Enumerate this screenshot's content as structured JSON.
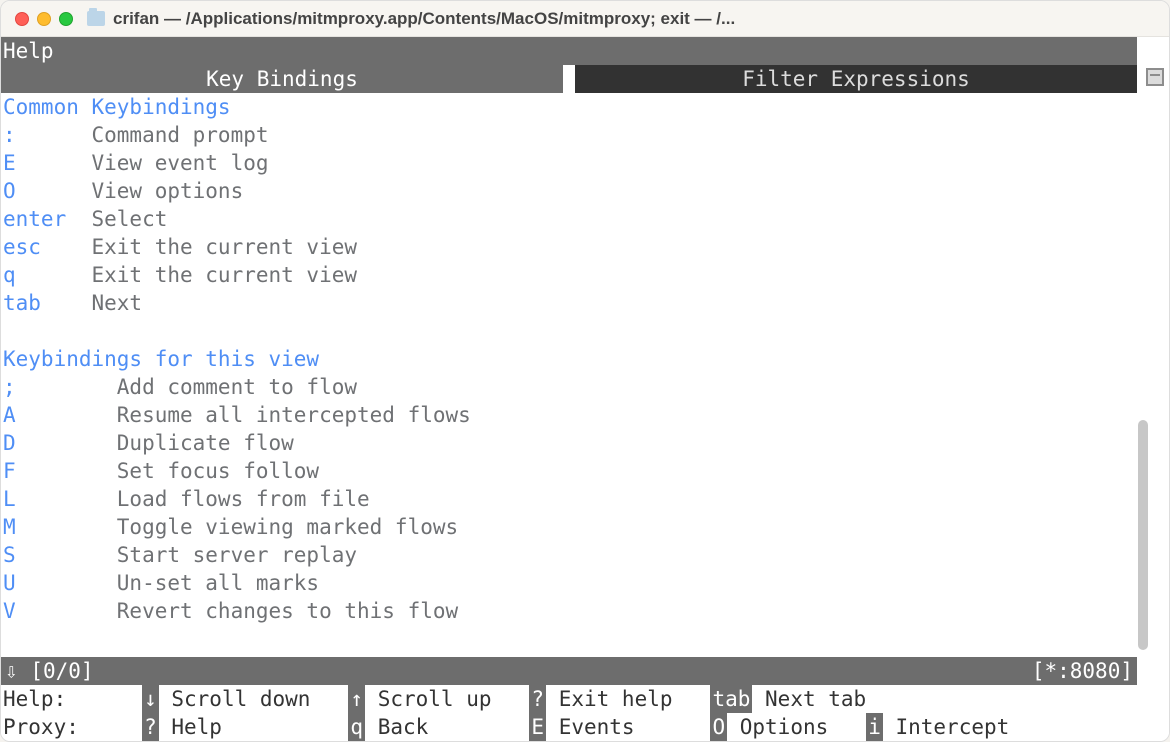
{
  "window": {
    "title": "crifan — /Applications/mitmproxy.app/Contents/MacOS/mitmproxy; exit — /..."
  },
  "header": "Help",
  "tabs": {
    "active": "Key Bindings",
    "inactive": "Filter Expressions"
  },
  "sections": [
    {
      "title": "Common Keybindings",
      "keyWidth": "w6",
      "items": [
        {
          "key": ":",
          "desc": "Command prompt"
        },
        {
          "key": "E",
          "desc": "View event log"
        },
        {
          "key": "O",
          "desc": "View options"
        },
        {
          "key": "enter",
          "desc": "Select"
        },
        {
          "key": "esc",
          "desc": "Exit the current view"
        },
        {
          "key": "q",
          "desc": "Exit the current view"
        },
        {
          "key": "tab",
          "desc": "Next"
        }
      ]
    },
    {
      "title": "Keybindings for this view",
      "keyWidth": "w8",
      "items": [
        {
          "key": ";",
          "desc": "Add comment to flow"
        },
        {
          "key": "A",
          "desc": "Resume all intercepted flows"
        },
        {
          "key": "D",
          "desc": "Duplicate flow"
        },
        {
          "key": "F",
          "desc": "Set focus follow"
        },
        {
          "key": "L",
          "desc": "Load flows from file"
        },
        {
          "key": "M",
          "desc": "Toggle viewing marked flows"
        },
        {
          "key": "S",
          "desc": "Start server replay"
        },
        {
          "key": "U",
          "desc": "Un-set all marks"
        },
        {
          "key": "V",
          "desc": "Revert changes to this flow"
        }
      ]
    }
  ],
  "status": {
    "leftArrow": "⇩",
    "count": "[0/0]",
    "right": "[*:8080]"
  },
  "footer": {
    "rows": [
      {
        "label": "Help:",
        "items": [
          {
            "key": "↓",
            "action": "Scroll down"
          },
          {
            "key": "↑",
            "action": "Scroll up"
          },
          {
            "key": "?",
            "action": "Exit help"
          },
          {
            "key": "tab",
            "action": "Next tab"
          }
        ]
      },
      {
        "label": "Proxy:",
        "items": [
          {
            "key": "?",
            "action": "Help"
          },
          {
            "key": "q",
            "action": "Back"
          },
          {
            "key": "E",
            "action": "Events"
          },
          {
            "key": "O",
            "action": "Options"
          },
          {
            "key": "i",
            "action": "Intercept"
          }
        ]
      }
    ]
  },
  "footerColWidths": [
    11,
    14,
    12,
    12,
    10,
    10
  ]
}
